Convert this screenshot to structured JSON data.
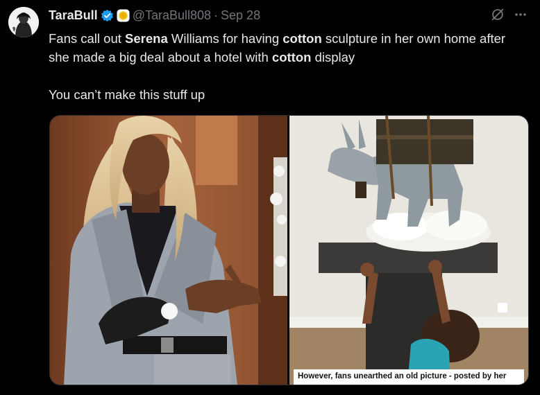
{
  "author": {
    "display_name": "TaraBull",
    "handle": "@TaraBull808",
    "separator": "·",
    "date": "Sep 28",
    "verified_color": "#1d9bf0",
    "badge_color": "#f5c518"
  },
  "tweet": {
    "line1_parts": [
      {
        "text": "Fans call out ",
        "bold": false
      },
      {
        "text": "Serena",
        "bold": true
      },
      {
        "text": " Williams for having ",
        "bold": false
      },
      {
        "text": "cotton",
        "bold": true
      },
      {
        "text": " sculpture in her own home after she made a big deal about a hotel with ",
        "bold": false
      },
      {
        "text": "cotton",
        "bold": true
      },
      {
        "text": " display",
        "bold": false
      }
    ],
    "line2": "You can’t make this stuff up"
  },
  "media": {
    "right_caption": "However, fans unearthed an old picture - posted by her"
  },
  "icons": {
    "grok": "grok-icon",
    "more": "more-options-icon",
    "verified": "verified-badge-icon",
    "affiliate": "affiliate-badge-icon"
  }
}
